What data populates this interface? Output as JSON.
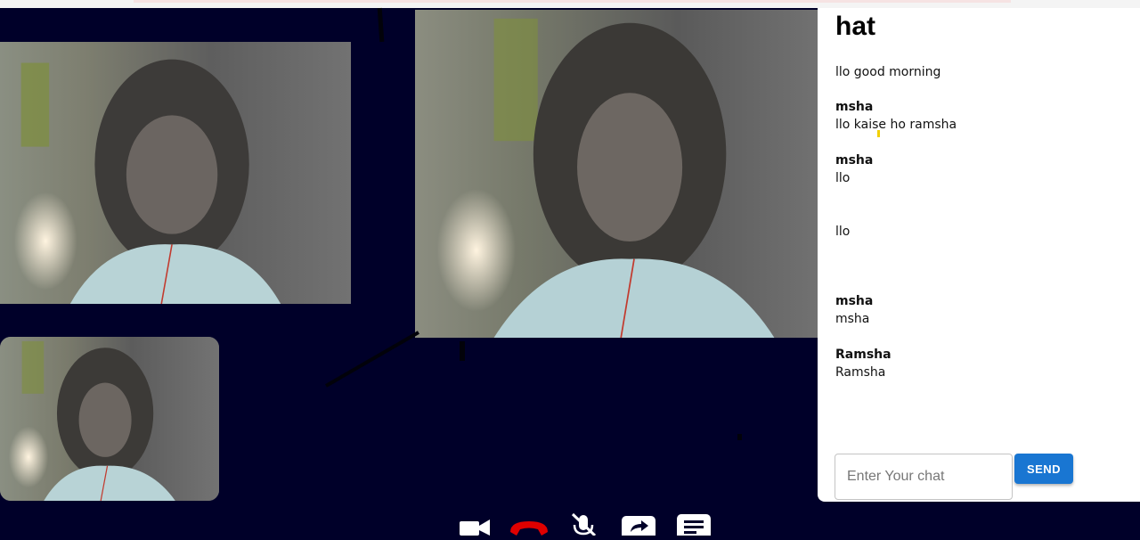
{
  "chat": {
    "title": "hat",
    "messages": [
      {
        "sender": "",
        "text": "llo good morning"
      },
      {
        "sender": "msha",
        "text": "llo kaise ho ramsha"
      },
      {
        "sender": "msha",
        "text": "llo"
      },
      {
        "sender": "",
        "text": "llo"
      },
      {
        "sender": "msha",
        "text": "msha"
      },
      {
        "sender": "Ramsha",
        "text": "Ramsha"
      }
    ],
    "input_placeholder": "Enter Your chat",
    "send_label": "SEND"
  },
  "controls": {
    "items": [
      "video-camera-icon",
      "hang-up-phone-icon",
      "mic-off-icon",
      "share-screen-icon",
      "chat-icon"
    ]
  },
  "colors": {
    "background": "#000029",
    "chat_panel": "#ffffff",
    "send_button": "#1976d2",
    "hang_up": "#e00000"
  }
}
